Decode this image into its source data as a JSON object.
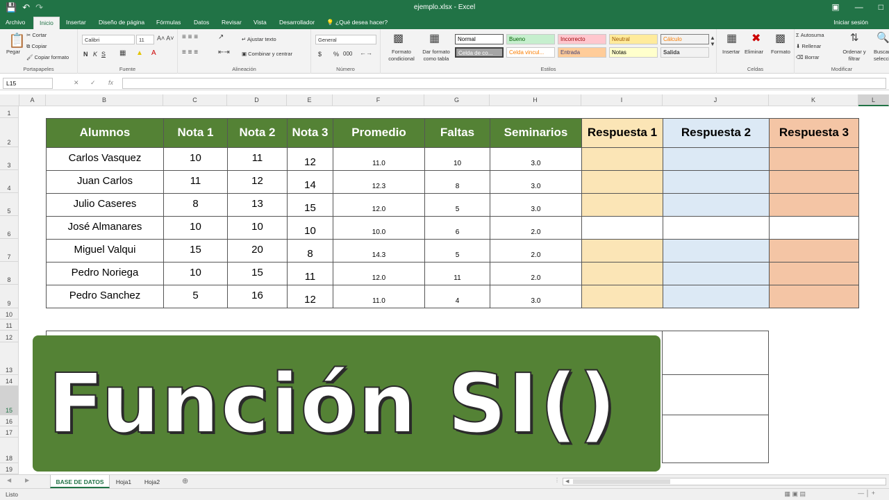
{
  "window": {
    "title": "ejemplo.xlsx - Excel",
    "save_icon": "save-icon",
    "undo_icon": "undo-icon",
    "redo_icon": "redo-icon"
  },
  "menu_tabs": [
    "Archivo",
    "Inicio",
    "Insertar",
    "Diseño de página",
    "Fórmulas",
    "Datos",
    "Revisar",
    "Vista",
    "Desarrollador"
  ],
  "tell_me": "¿Qué desea hacer?",
  "sign_in": "Iniciar sesión",
  "ribbon": {
    "clipboard": {
      "paste": "Pegar",
      "cut": "Cortar",
      "copy": "Copiar",
      "format_painter": "Copiar formato",
      "label": "Portapapeles"
    },
    "font": {
      "name": "Calibri",
      "size": "11",
      "bold": "N",
      "italic": "K",
      "underline": "S",
      "label": "Fuente"
    },
    "alignment": {
      "wrap": "Ajustar texto",
      "merge": "Combinar y centrar",
      "label": "Alineación"
    },
    "number": {
      "format": "General",
      "currency": "$",
      "percent": "%",
      "thousands": "000",
      "label": "Número"
    },
    "styles": {
      "conditional": "Formato condicional",
      "as_table": "Dar formato como tabla",
      "cells": [
        "Normal",
        "Bueno",
        "Incorrecto",
        "Neutral",
        "Cálculo",
        "Celda de co...",
        "Celda vincul...",
        "Entrada",
        "Notas",
        "Salida"
      ],
      "label": "Estilos"
    },
    "cells": {
      "insert": "Insertar",
      "delete": "Eliminar",
      "format": "Formato",
      "label": "Celdas"
    },
    "editing": {
      "autosum": "Autosuma",
      "fill": "Rellenar",
      "clear": "Borrar",
      "sort": "Ordenar y filtrar",
      "find": "Buscar y seleccionar",
      "label": "Modificar"
    }
  },
  "formula_bar": {
    "name_box": "L15",
    "fx": "fx",
    "value": ""
  },
  "columns": [
    "A",
    "B",
    "C",
    "D",
    "E",
    "F",
    "G",
    "H",
    "I",
    "J",
    "K",
    "L"
  ],
  "rows": [
    "1",
    "2",
    "3",
    "4",
    "5",
    "6",
    "7",
    "8",
    "9",
    "10",
    "11",
    "12",
    "13",
    "14",
    "15",
    "16",
    "17",
    "18",
    "19"
  ],
  "table": {
    "headers": [
      "Alumnos",
      "Nota 1",
      "Nota 2",
      "Nota 3",
      "Promedio",
      "Faltas",
      "Seminarios",
      "Respuesta 1",
      "Respuesta 2",
      "Respuesta 3"
    ],
    "rows": [
      {
        "name": "Carlos Vasquez",
        "n1": "10",
        "n2": "11",
        "n3": "12",
        "prom": "11.0",
        "faltas": "10",
        "sem": "3.0",
        "filled": true
      },
      {
        "name": "Juan Carlos",
        "n1": "11",
        "n2": "12",
        "n3": "14",
        "prom": "12.3",
        "faltas": "8",
        "sem": "3.0",
        "filled": true
      },
      {
        "name": "Julio Caseres",
        "n1": "8",
        "n2": "13",
        "n3": "15",
        "prom": "12.0",
        "faltas": "5",
        "sem": "3.0",
        "filled": true
      },
      {
        "name": "José Almanares",
        "n1": "10",
        "n2": "10",
        "n3": "10",
        "prom": "10.0",
        "faltas": "6",
        "sem": "2.0",
        "filled": false
      },
      {
        "name": "Miguel Valqui",
        "n1": "15",
        "n2": "20",
        "n3": "8",
        "prom": "14.3",
        "faltas": "5",
        "sem": "2.0",
        "filled": true
      },
      {
        "name": "Pedro Noriega",
        "n1": "10",
        "n2": "15",
        "n3": "11",
        "prom": "12.0",
        "faltas": "11",
        "sem": "2.0",
        "filled": true
      },
      {
        "name": "Pedro Sanchez",
        "n1": "5",
        "n2": "16",
        "n3": "12",
        "prom": "11.0",
        "faltas": "4",
        "sem": "3.0",
        "filled": true
      }
    ],
    "colors": {
      "header_green": "#548235",
      "resp1": "#fbe5b6",
      "resp2": "#dce9f5",
      "resp3": "#f4c5a5"
    }
  },
  "banner": {
    "text": "Función SI()",
    "background": "#548235"
  },
  "sheets": [
    "BASE DE DATOS",
    "Hoja1",
    "Hoja2"
  ],
  "status": {
    "ready": "Listo"
  }
}
